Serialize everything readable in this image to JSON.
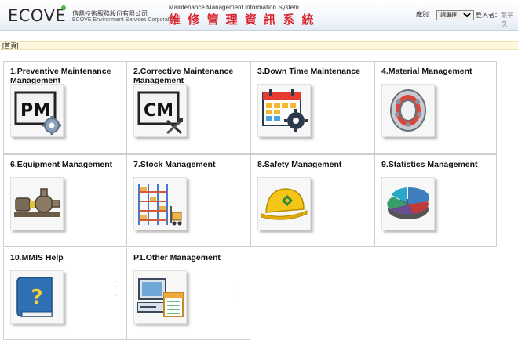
{
  "header": {
    "logo": "ECOVE",
    "company_cn": "信鼎技術服務股份有限公司",
    "company_en": "ECOVE Environment Services Corporation",
    "system_en": "Maintenance Management Information System",
    "system_cn": "維 修 管 理 資 訊 系 統",
    "filter_label": "廠別：",
    "filter_value": "請選擇...",
    "login_label": "登入者：",
    "login_name": "葉平良"
  },
  "breadcrumb": "[首頁]",
  "tiles": [
    {
      "title": "1.Preventive Maintenance Management",
      "icon": "pm-gear-icon"
    },
    {
      "title": "2.Corrective Maintenance Management",
      "icon": "cm-tools-icon"
    },
    {
      "title": "3.Down Time  Maintenance",
      "icon": "calendar-gear-icon"
    },
    {
      "title": "4.Material Management",
      "icon": "bearing-icon"
    },
    {
      "title": "6.Equipment Management",
      "icon": "pump-icon"
    },
    {
      "title": "7.Stock Management",
      "icon": "warehouse-rack-icon"
    },
    {
      "title": "8.Safety Management",
      "icon": "safety-helmet-icon"
    },
    {
      "title": "9.Statistics Management",
      "icon": "pie-chart-icon"
    },
    {
      "title": "10.MMIS Help",
      "icon": "help-book-icon"
    },
    {
      "title": "P1.Other Management",
      "icon": "computer-spreadsheet-icon"
    }
  ]
}
